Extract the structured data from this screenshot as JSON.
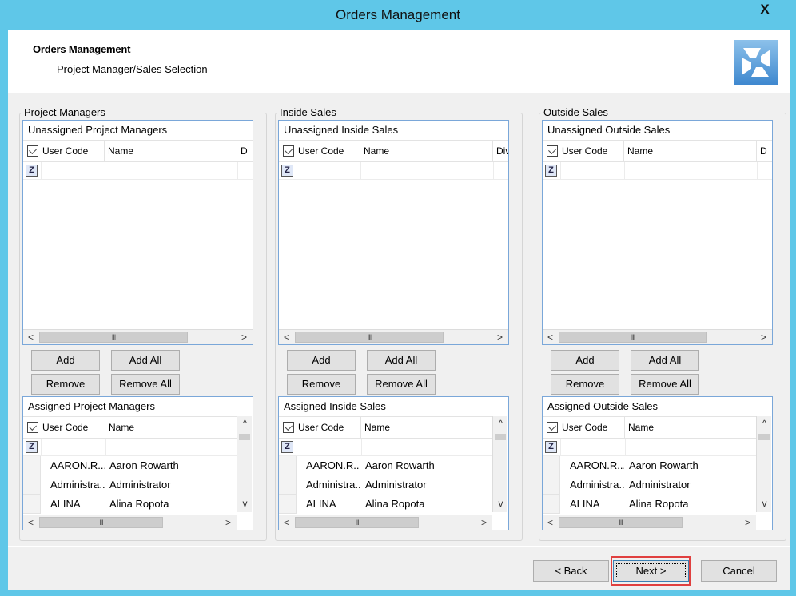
{
  "window": {
    "title": "Orders Management",
    "close_glyph": "X"
  },
  "header": {
    "title": "Orders Management",
    "subtitle": "Project Manager/Sales Selection",
    "logo_icon": "app-logo-icon"
  },
  "groups": [
    {
      "title": "Project Managers",
      "unassigned_title": "Unassigned Project Managers",
      "assigned_title": "Assigned Project Managers",
      "cols": [
        "User Code",
        "Name",
        "D"
      ],
      "rows": [
        {
          "code": "AARON.R...",
          "name": "Aaron Rowarth"
        },
        {
          "code": "Administra...",
          "name": "Administrator"
        },
        {
          "code": "ALINA",
          "name": "Alina Ropota"
        }
      ]
    },
    {
      "title": "Inside Sales",
      "unassigned_title": "Unassigned Inside Sales",
      "assigned_title": "Assigned Inside Sales",
      "cols": [
        "User Code",
        "Name",
        "Div"
      ],
      "rows": [
        {
          "code": "AARON.R...",
          "name": "Aaron Rowarth"
        },
        {
          "code": "Administra...",
          "name": "Administrator"
        },
        {
          "code": "ALINA",
          "name": "Alina Ropota"
        }
      ]
    },
    {
      "title": "Outside Sales",
      "unassigned_title": "Unassigned Outside Sales",
      "assigned_title": "Assigned Outside Sales",
      "cols": [
        "User Code",
        "Name",
        "D"
      ],
      "rows": [
        {
          "code": "AARON.R...",
          "name": "Aaron Rowarth"
        },
        {
          "code": "Administra...",
          "name": "Administrator"
        },
        {
          "code": "ALINA",
          "name": "Alina Ropota"
        }
      ]
    }
  ],
  "buttons": {
    "add": "Add",
    "add_all": "Add All",
    "remove": "Remove",
    "remove_all": "Remove All"
  },
  "scroll": {
    "left": "<",
    "right": ">",
    "grip": "III",
    "up": "^",
    "down": "v"
  },
  "footer": {
    "back": "< Back",
    "next": "Next >",
    "cancel": "Cancel"
  },
  "filter_glyph": "Z"
}
